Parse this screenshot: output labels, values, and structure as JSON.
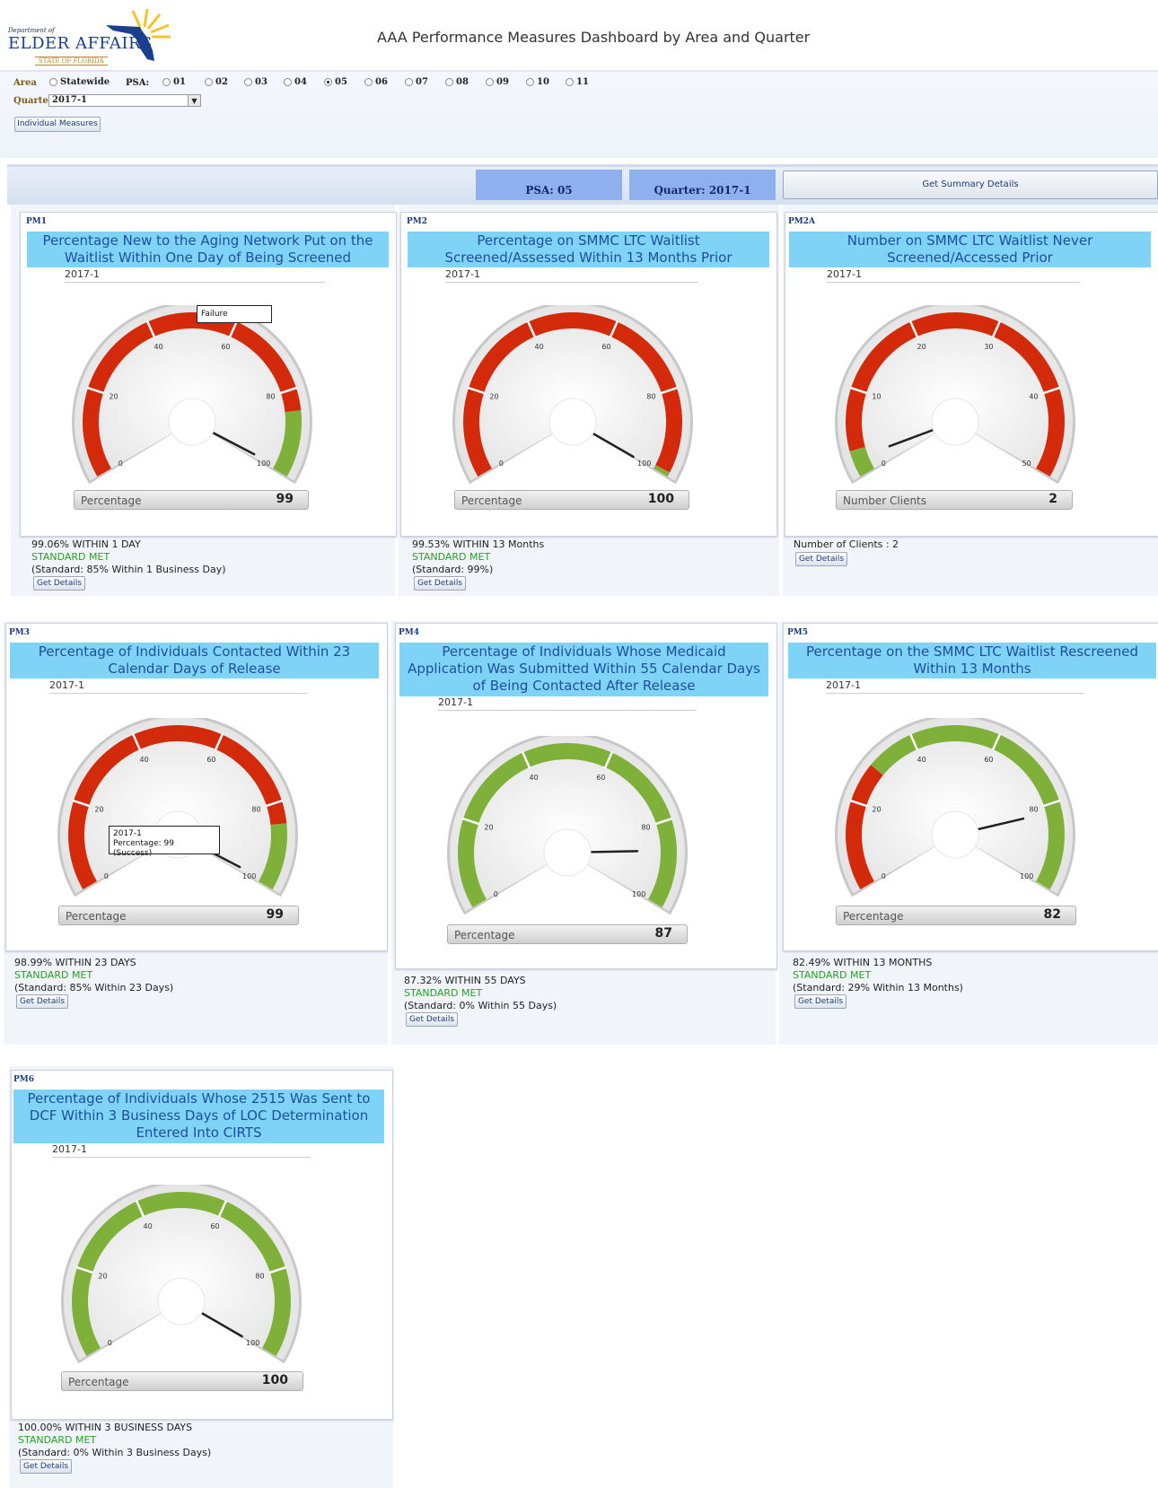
{
  "header": {
    "logo_small": "Department of",
    "logo_name": "ELDER AFFAIRS",
    "logo_state": "STATE OF FLORIDA",
    "title": "AAA Performance Measures Dashboard by Area and Quarter"
  },
  "filters": {
    "area_label": "Area",
    "statewide": "Statewide",
    "psa_label": "PSA:",
    "psa_options": [
      "01",
      "02",
      "03",
      "04",
      "05",
      "06",
      "07",
      "08",
      "09",
      "10",
      "11"
    ],
    "psa_selected": "05",
    "quarter_label": "Quarter",
    "quarter_value": "2017-1",
    "individual_button": "Individual Measures"
  },
  "summary": {
    "psa": "PSA: 05",
    "quarter": "Quarter: 2017-1",
    "details_button": "Get Summary Details"
  },
  "colors": {
    "red": "#d42a0c",
    "green": "#7fb03a",
    "title_bg": "#7fd3f7",
    "met_text": "#25a025"
  },
  "pm1": {
    "code": "PM1",
    "title": "Percentage New to the Aging Network Put on the Waitlist Within One Day of Being Screened",
    "quarter": "2017-1",
    "tooltip": "Failure",
    "readout_label": "Percentage",
    "value": "99",
    "line1": "99.06% WITHIN 1 DAY",
    "line2": "STANDARD MET",
    "line3": "(Standard: 85% Within 1 Business Day)",
    "button": "Get Details"
  },
  "pm2": {
    "code": "PM2",
    "title": "Percentage on SMMC LTC Waitlist Screened/Assessed Within 13 Months Prior",
    "quarter": "2017-1",
    "readout_label": "Percentage",
    "value": "100",
    "line1": "99.53% WITHIN 13 Months",
    "line2": "STANDARD MET",
    "line3": "(Standard: 99%)",
    "button": "Get Details"
  },
  "pm2a": {
    "code": "PM2A",
    "title": "Number on SMMC LTC Waitlist Never Screened/Accessed Prior",
    "quarter": "2017-1",
    "readout_label": "Number Clients",
    "value": "2",
    "line1": "Number of Clients : 2",
    "button": "Get Details"
  },
  "pm3": {
    "code": "PM3",
    "title": "Percentage of Individuals Contacted Within 23 Calendar Days of Release",
    "quarter": "2017-1",
    "tooltip_line1": "2017-1",
    "tooltip_line2": "Percentage: 99   (Success)",
    "readout_label": "Percentage",
    "value": "99",
    "line1": "98.99% WITHIN 23 DAYS",
    "line2": "STANDARD MET",
    "line3": "(Standard: 85% Within 23 Days)",
    "button": "Get Details"
  },
  "pm4": {
    "code": "PM4",
    "title": "Percentage of Individuals Whose Medicaid Application Was Submitted Within 55 Calendar Days of Being Contacted After Release",
    "quarter": "2017-1",
    "readout_label": "Percentage",
    "value": "87",
    "line1": "87.32% WITHIN 55 DAYS",
    "line2": "STANDARD MET",
    "line3": "(Standard: 0% Within 55 Days)",
    "button": "Get Details"
  },
  "pm5": {
    "code": "PM5",
    "title": "Percentage on the SMMC LTC Waitlist Rescreened Within 13 Months",
    "quarter": "2017-1",
    "readout_label": "Percentage",
    "value": "82",
    "line1": "82.49% WITHIN 13 MONTHS",
    "line2": "STANDARD MET",
    "line3": "(Standard: 29% Within 13 Months)",
    "button": "Get Details"
  },
  "pm6": {
    "code": "PM6",
    "title": "Percentage of Individuals Whose 2515 Was Sent to DCF Within 3 Business Days of LOC Determination Entered Into CIRTS",
    "quarter": "2017-1",
    "readout_label": "Percentage",
    "value": "100",
    "line1": "100.00% WITHIN 3 BUSINESS DAYS",
    "line2": "STANDARD MET",
    "line3": "(Standard: 0% Within 3 Business Days)",
    "button": "Get Details"
  },
  "gauges": {
    "pm1": {
      "min": 0,
      "max": 100,
      "value": 99,
      "ticks": [
        0,
        20,
        40,
        60,
        80,
        100
      ],
      "bands": [
        {
          "from": 0,
          "to": 85,
          "color": "red"
        },
        {
          "from": 85,
          "to": 100,
          "color": "green"
        }
      ]
    },
    "pm2": {
      "min": 0,
      "max": 100,
      "value": 100,
      "ticks": [
        0,
        20,
        40,
        60,
        80,
        100
      ],
      "bands": [
        {
          "from": 0,
          "to": 99,
          "color": "red"
        },
        {
          "from": 99,
          "to": 100,
          "color": "green"
        }
      ]
    },
    "pm2a": {
      "min": 0,
      "max": 50,
      "value": 2,
      "ticks": [
        0,
        10,
        20,
        30,
        40,
        50
      ],
      "bands": [
        {
          "from": 0,
          "to": 3,
          "color": "green"
        },
        {
          "from": 3,
          "to": 50,
          "color": "red"
        }
      ]
    },
    "pm3": {
      "min": 0,
      "max": 100,
      "value": 99,
      "ticks": [
        0,
        20,
        40,
        60,
        80,
        100
      ],
      "bands": [
        {
          "from": 0,
          "to": 85,
          "color": "red"
        },
        {
          "from": 85,
          "to": 100,
          "color": "green"
        }
      ]
    },
    "pm4": {
      "min": 0,
      "max": 100,
      "value": 87,
      "ticks": [
        0,
        20,
        40,
        60,
        80,
        100
      ],
      "bands": [
        {
          "from": 0,
          "to": 100,
          "color": "green"
        }
      ]
    },
    "pm5": {
      "min": 0,
      "max": 100,
      "value": 82,
      "ticks": [
        0,
        20,
        40,
        60,
        80,
        100
      ],
      "bands": [
        {
          "from": 0,
          "to": 29,
          "color": "red"
        },
        {
          "from": 29,
          "to": 100,
          "color": "green"
        }
      ]
    },
    "pm6": {
      "min": 0,
      "max": 100,
      "value": 100,
      "ticks": [
        0,
        20,
        40,
        60,
        80,
        100
      ],
      "bands": [
        {
          "from": 0,
          "to": 100,
          "color": "green"
        }
      ]
    }
  }
}
